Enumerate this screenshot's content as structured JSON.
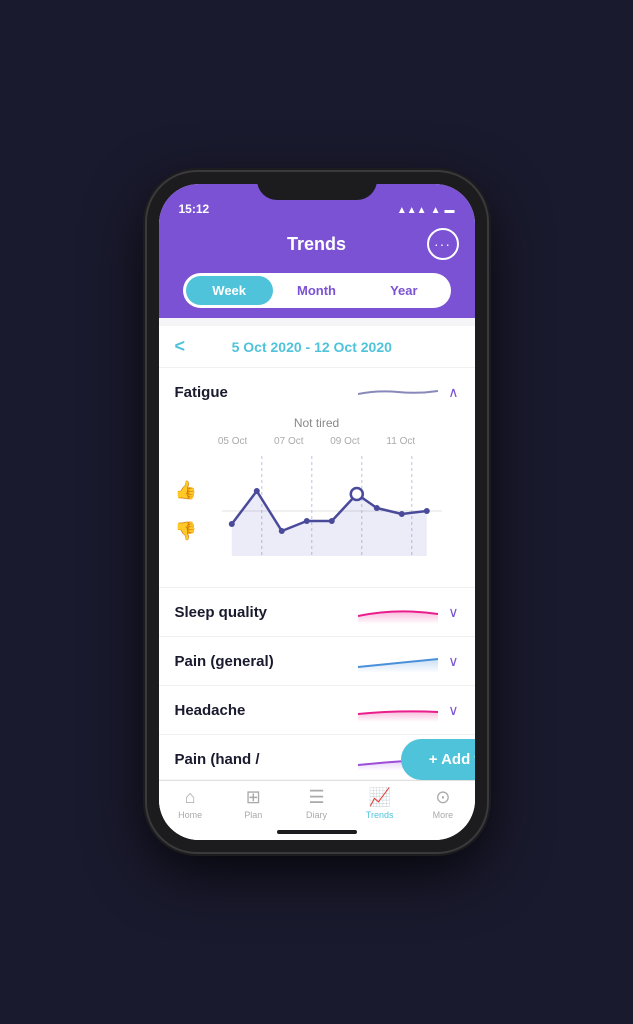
{
  "status": {
    "time": "15:12",
    "signal": "▲▲▲",
    "wifi": "WiFi",
    "battery": "🔋"
  },
  "header": {
    "title": "Trends",
    "more_button_label": "···"
  },
  "tabs": [
    {
      "id": "week",
      "label": "Week",
      "active": true
    },
    {
      "id": "month",
      "label": "Month",
      "active": false
    },
    {
      "id": "year",
      "label": "Year",
      "active": false
    }
  ],
  "date_nav": {
    "arrow": "<",
    "range": "5 Oct 2020 - 12 Oct 2020"
  },
  "trends": [
    {
      "id": "fatigue",
      "title": "Fatigue",
      "expanded": true,
      "chart_label": "Not tired",
      "dates": [
        "05 Oct",
        "07 Oct",
        "09 Oct",
        "11 Oct"
      ],
      "chevron": "∧"
    },
    {
      "id": "sleep",
      "title": "Sleep quality",
      "expanded": false,
      "chevron": "∨",
      "line_color": "#e91e8c"
    },
    {
      "id": "pain_general",
      "title": "Pain (general)",
      "expanded": false,
      "chevron": "∨",
      "line_color": "#4a90d9"
    },
    {
      "id": "headache",
      "title": "Headache",
      "expanded": false,
      "chevron": "∨",
      "line_color": "#e91e8c"
    },
    {
      "id": "pain_hand",
      "title": "Pain (hand /",
      "expanded": false,
      "chevron": "∨",
      "line_color": "#9c4dd9"
    }
  ],
  "add_trends_label": "+ Add trends",
  "bottom_nav": [
    {
      "id": "home",
      "label": "Home",
      "icon": "⌂",
      "active": false
    },
    {
      "id": "plan",
      "label": "Plan",
      "icon": "📋",
      "active": false
    },
    {
      "id": "diary",
      "label": "Diary",
      "icon": "📓",
      "active": false
    },
    {
      "id": "trends",
      "label": "Trends",
      "icon": "📈",
      "active": true
    },
    {
      "id": "more",
      "label": "More",
      "icon": "⊙",
      "active": false
    }
  ]
}
